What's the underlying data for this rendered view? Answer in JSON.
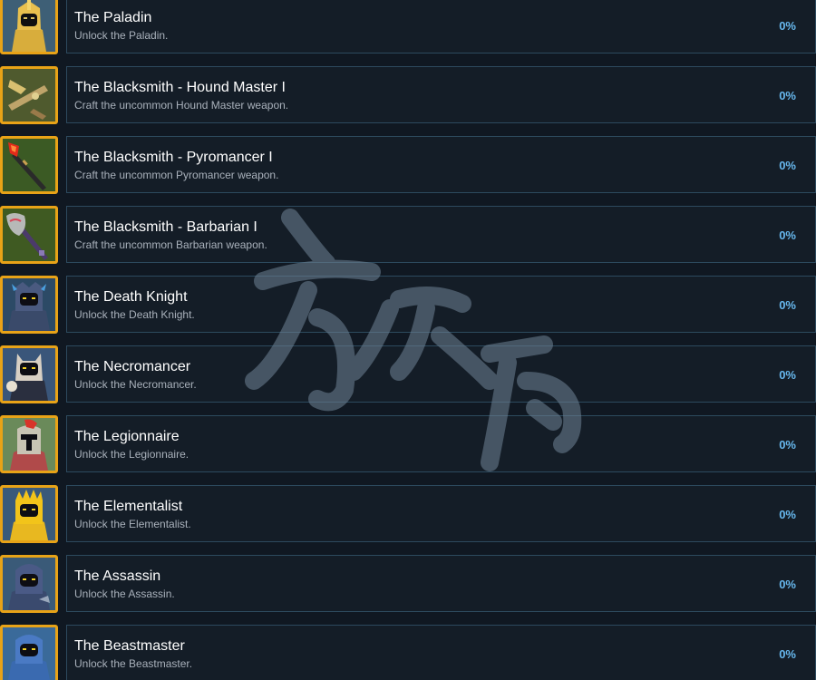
{
  "achievements": [
    {
      "title": "The Paladin",
      "description": "Unlock the Paladin.",
      "percent": "0%",
      "icon": "paladin-icon"
    },
    {
      "title": "The Blacksmith - Hound Master I",
      "description": "Craft the uncommon Hound Master weapon.",
      "percent": "0%",
      "icon": "hound-master-weapon-icon"
    },
    {
      "title": "The Blacksmith - Pyromancer I",
      "description": "Craft the uncommon Pyromancer weapon.",
      "percent": "0%",
      "icon": "pyromancer-staff-icon"
    },
    {
      "title": "The Blacksmith - Barbarian I",
      "description": "Craft the uncommon Barbarian weapon.",
      "percent": "0%",
      "icon": "barbarian-axe-icon"
    },
    {
      "title": "The Death Knight",
      "description": "Unlock the Death Knight.",
      "percent": "0%",
      "icon": "death-knight-icon"
    },
    {
      "title": "The Necromancer",
      "description": "Unlock the Necromancer.",
      "percent": "0%",
      "icon": "necromancer-icon"
    },
    {
      "title": "The Legionnaire",
      "description": "Unlock the Legionnaire.",
      "percent": "0%",
      "icon": "legionnaire-icon"
    },
    {
      "title": "The Elementalist",
      "description": "Unlock the Elementalist.",
      "percent": "0%",
      "icon": "elementalist-icon"
    },
    {
      "title": "The Assassin",
      "description": "Unlock the Assassin.",
      "percent": "0%",
      "icon": "assassin-icon"
    },
    {
      "title": "The Beastmaster",
      "description": "Unlock the Beastmaster.",
      "percent": "0%",
      "icon": "beastmaster-icon"
    }
  ],
  "colors": {
    "background": "#101822",
    "card_border": "#2d4a5e",
    "icon_frame": "#e8a317",
    "percent_text": "#67b8ee"
  }
}
